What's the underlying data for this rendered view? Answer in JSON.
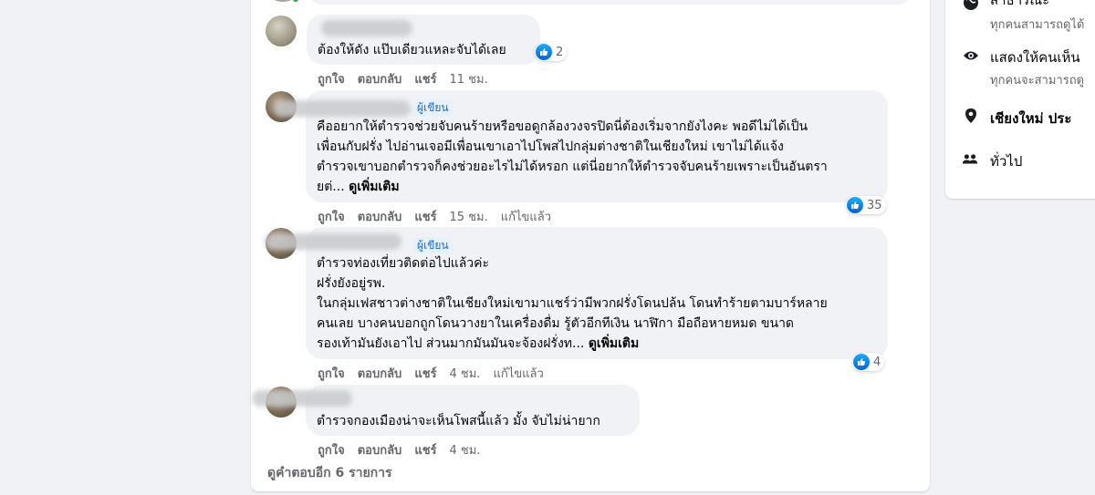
{
  "prev_comment": {
    "text": "ต้องให้ดัง แป๊บเดียวแหละจับได้เลย",
    "reactions": "2",
    "actions": {
      "like": "ถูกใจ",
      "reply": "ตอบกลับ",
      "share": "แชร์",
      "time": "11 ชม."
    }
  },
  "comments": [
    {
      "badge": "ผู้เขียน",
      "lines": [
        "คืออยากให้ตำรวจช่วยจับคนร้ายหรือขอดูกล้องวงจรปิดนี่ต้องเริ่มจากยังไงคะ พอดีไม่ได้เป็น",
        "เพื่อนกับฝรั่ง ไปอ่านเจอมีเพื่อนเขาเอาไปโพสไปกลุ่มต่างชาติในเชียงใหม่ เขาไม่ได้แจ้ง",
        "ตำรวจเขาบอกตำรวจก็คงช่วยอะไรไม่ได้หรอก แต่นี่อยากให้ตำรวจจับคนร้ายเพราะเป็นอันตรา"
      ],
      "last_line": "ยต่...",
      "see_more": "ดูเพิ่มเติม",
      "reactions": "35",
      "actions": {
        "like": "ถูกใจ",
        "reply": "ตอบกลับ",
        "share": "แชร์",
        "time": "15 ชม.",
        "edited": "แก้ไขแล้ว"
      }
    },
    {
      "badge": "ผู้เขียน",
      "lines": [
        "ตำรวจท่องเที่ยวติดต่อไปแล้วค่ะ",
        "ฝรั่งยังอยู่รพ.",
        "ในกลุ่มเฟสชาวต่างชาติในเชียงใหม่เขามาแชร์ว่ามีพวกฝรั่งโดนปล้น โดนทำร้ายตามบาร์หลาย",
        "คนเลย บางคนบอกถูกโดนวางยาในเครื่องดื่ม รู้ตัวอีกทีเงิน นาฬิกา มือถือหายหมด ขนาด"
      ],
      "last_line": "รองเท้ามันยังเอาไป ส่วนมากมันมันจะจ้องฝรั่งท...",
      "see_more": "ดูเพิ่มเติม",
      "reactions": "4",
      "actions": {
        "like": "ถูกใจ",
        "reply": "ตอบกลับ",
        "share": "แชร์",
        "time": "4 ชม.",
        "edited": "แก้ไขแล้ว"
      }
    },
    {
      "lines": [
        "ตำรวจกองเมืองน่าจะเห็นโพสนี้แล้ว มั้ง จับไม่น่ายาก"
      ],
      "actions": {
        "like": "ถูกใจ",
        "reply": "ตอบกลับ",
        "share": "แชร์",
        "time": "4 ชม."
      }
    }
  ],
  "more_replies": "ดูคำตอบอีก 6 รายการ",
  "sidebar": {
    "items": [
      {
        "icon": "globe-icon",
        "label": "สาธารณะ",
        "sub": "ทุกคนสามารถดูได้"
      },
      {
        "icon": "eye-icon",
        "label": "แสดงให้คนเห็น",
        "sub": "ทุกคนจะสามารถดู"
      },
      {
        "icon": "location-pin-icon",
        "label": "เชียงใหม่ ประ"
      },
      {
        "icon": "people-icon",
        "label": "ทั่วไป"
      }
    ]
  },
  "colors": {
    "accent": "#1877f2",
    "bubble": "#f0f2f5",
    "muted": "#65676b"
  }
}
